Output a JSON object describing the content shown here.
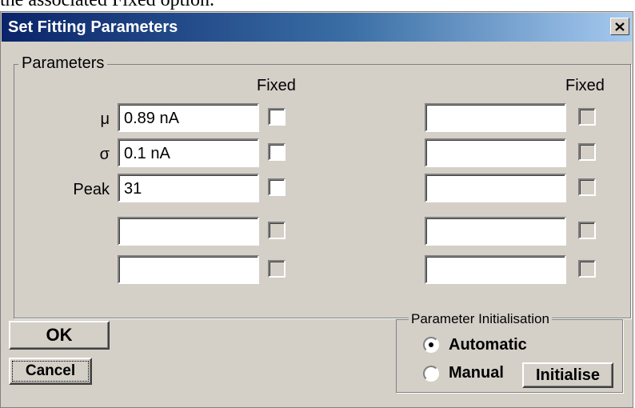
{
  "document": {
    "caption_fragment": "the associated Fixed option."
  },
  "dialog": {
    "title": "Set Fitting Parameters",
    "close_glyph": "✕",
    "parameters_group": {
      "label": "Parameters",
      "fixed_header_left": "Fixed",
      "fixed_header_right": "Fixed",
      "rows": [
        {
          "label": "μ",
          "value": "0.89 nA",
          "fixed_enabled": true
        },
        {
          "label": "σ",
          "value": "0.1 nA",
          "fixed_enabled": true
        },
        {
          "label": "Peak",
          "value": "31",
          "fixed_enabled": true
        },
        {
          "label": "",
          "value": "",
          "fixed_enabled": false
        },
        {
          "label": "",
          "value": "",
          "fixed_enabled": false
        }
      ]
    },
    "buttons": {
      "ok": "OK",
      "cancel": "Cancel",
      "initialise": "Initialise"
    },
    "init_group": {
      "label": "Parameter Initialisation",
      "options": [
        {
          "label": "Automatic",
          "selected": true
        },
        {
          "label": "Manual",
          "selected": false
        }
      ]
    }
  },
  "colors": {
    "window_bg": "#d4d0c8",
    "title_start": "#0a246a",
    "title_end": "#a6caf0"
  }
}
